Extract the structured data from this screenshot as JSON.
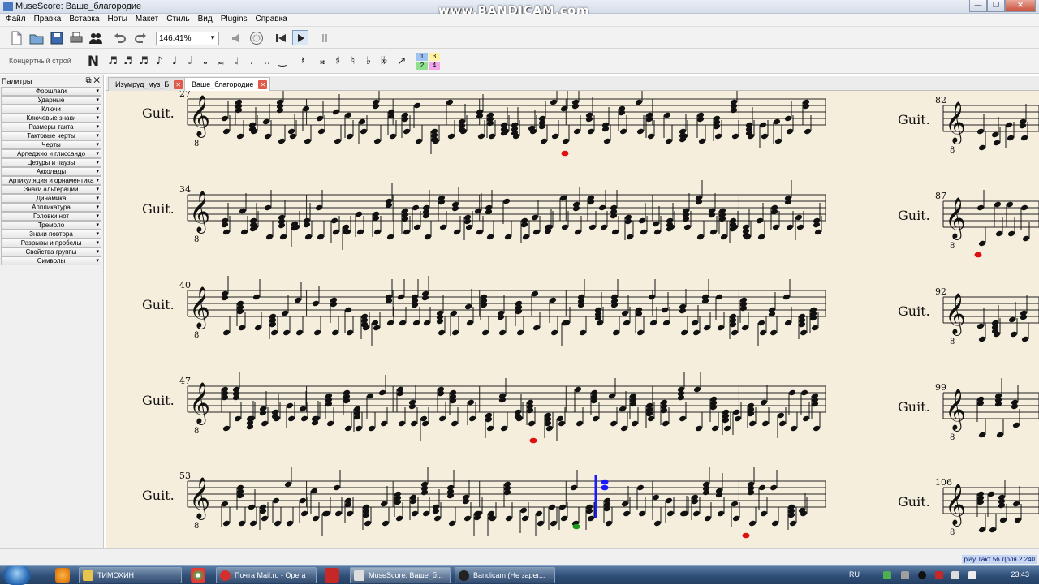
{
  "window": {
    "title": "MuseScore: Ваше_благородие",
    "watermark": "www.BANDICAM.com",
    "buttons": [
      "—",
      "❐",
      "✕"
    ]
  },
  "menu": [
    "Файл",
    "Правка",
    "Вставка",
    "Ноты",
    "Макет",
    "Стиль",
    "Вид",
    "Plugins",
    "Справка"
  ],
  "toolbar": {
    "zoom": "146.41%",
    "concert_pitch": "Концертный строй",
    "note_input": "N",
    "voices": [
      "1",
      "2",
      "3",
      "4"
    ]
  },
  "palettes": {
    "header": "Палитры",
    "items": [
      "Форшлаги",
      "Ударные",
      "Ключи",
      "Ключевые знаки",
      "Размеры такта",
      "Тактовые черты",
      "Черты",
      "Арпеджио и глиссандо",
      "Цезуры и паузы",
      "Акколады",
      "Артикуляция и орнаментика",
      "Знаки альтерации",
      "Динамика",
      "Аппликатура",
      "Головки нот",
      "Тремоло",
      "Знаки повтора",
      "Разрывы и пробелы",
      "Свойства группы",
      "Символы"
    ]
  },
  "tabs": [
    {
      "label": "Изумруд_муз_Б"
    },
    {
      "label": "Ваше_благородие"
    }
  ],
  "score": {
    "instrument": "Guit.",
    "left_measures": [
      "27",
      "34",
      "40",
      "47",
      "53"
    ],
    "right_measures": [
      "82",
      "87",
      "92",
      "99",
      "106"
    ],
    "clef_octave": "8"
  },
  "status": {
    "text": "play  Такт  56 Доля  2.240"
  },
  "taskbar": {
    "tasks": [
      "ТИМОХИН",
      "Почта Mail.ru - Opera",
      "MuseScore: Ваше_б...",
      "Bandicam (Не зарег..."
    ],
    "lang": "RU",
    "clock": "23:43"
  },
  "colors": {
    "paper": "#f5eedd",
    "selection": "#1a1aff",
    "note_red": "#e01010",
    "note_green": "#1a9a1a"
  }
}
